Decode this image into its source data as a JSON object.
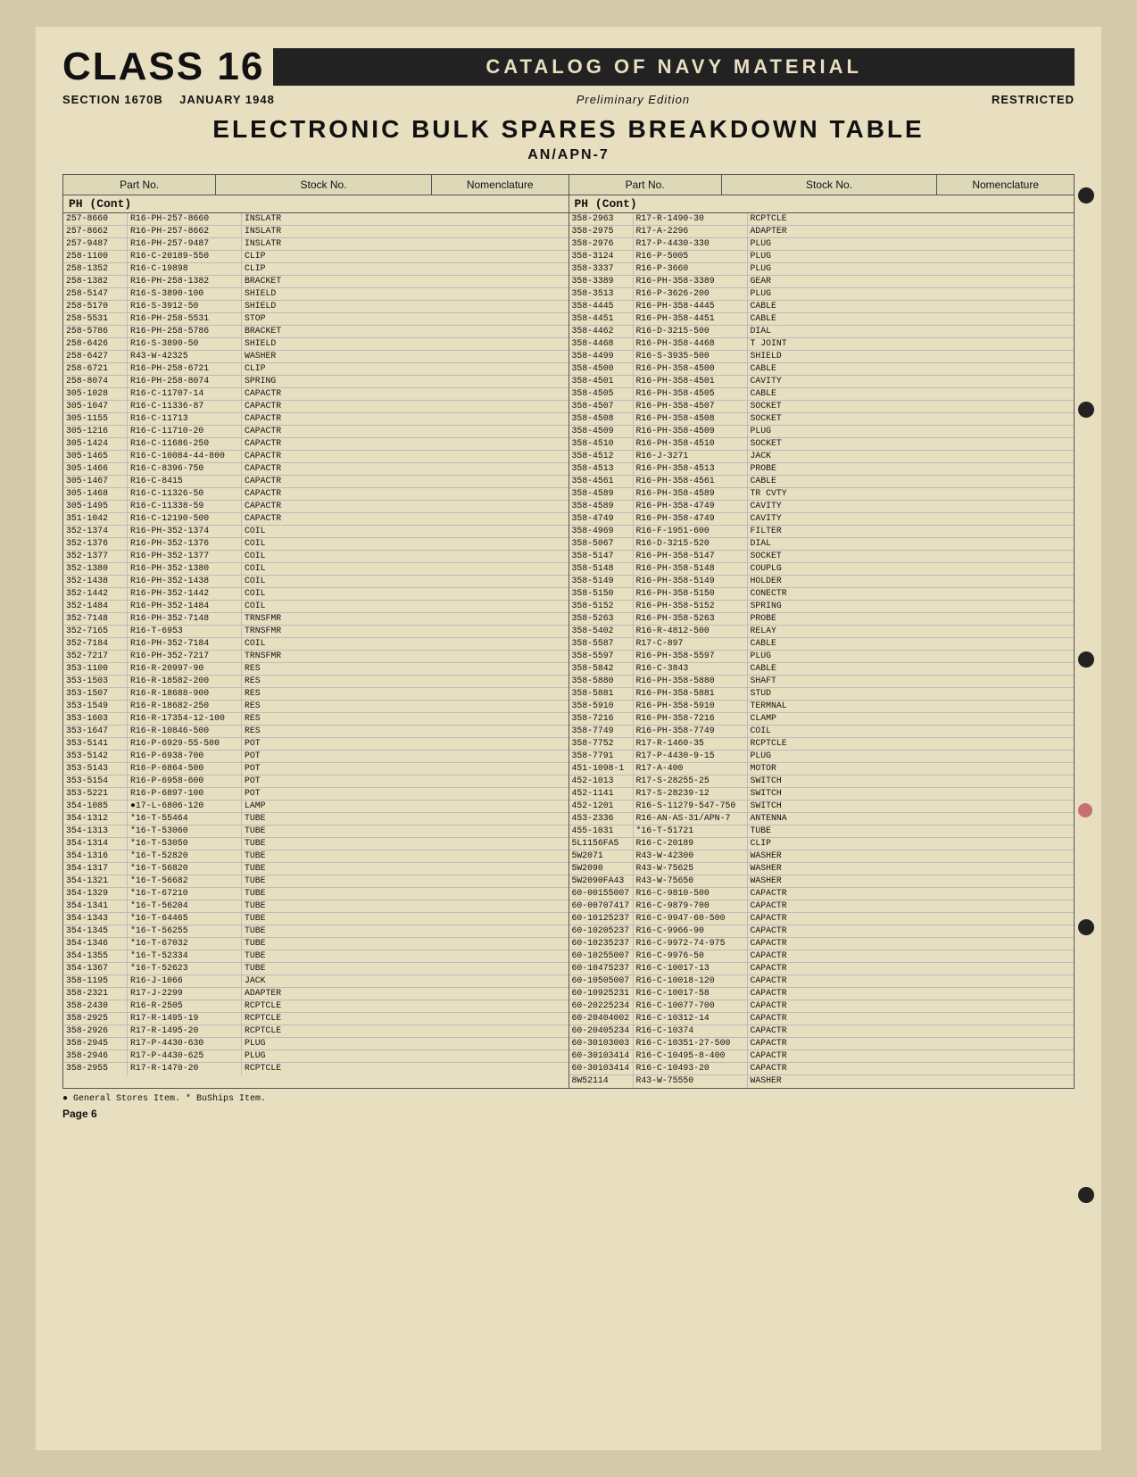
{
  "header": {
    "class_label": "CLASS 16",
    "catalog_title": "CATALOG OF NAVY MATERIAL",
    "section": "SECTION 1670B",
    "date": "JANUARY 1948",
    "edition": "Preliminary Edition",
    "restricted": "RESTRICTED",
    "page_title": "ELECTRONIC BULK SPARES BREAKDOWN TABLE",
    "sub_title": "AN/APN-7"
  },
  "table_headers": {
    "part_no": "Part No.",
    "stock_no": "Stock No.",
    "nomenclature": "Nomenclature",
    "part_no2": "Part No.",
    "stock_no2": "Stock No.",
    "nomenclature2": "Nomenclature"
  },
  "section_headers": {
    "left": "PH  (Cont)",
    "right": "PH  (Cont)"
  },
  "left_data": [
    [
      "257-8660",
      "R16-PH-257-8660",
      "INSLATR"
    ],
    [
      "257-8662",
      "R16-PH-257-8662",
      "INSLATR"
    ],
    [
      "257-9487",
      "R16-PH-257-9487",
      "INSLATR"
    ],
    [
      "258-1100",
      "R16-C-20189-550",
      "CLIP"
    ],
    [
      "258-1352",
      "R16-C-19898",
      "CLIP"
    ],
    [
      "258-1382",
      "R16-PH-258-1382",
      "BRACKET"
    ],
    [
      "258-5147",
      "R16-S-3890-100",
      "SHIELD"
    ],
    [
      "258-5170",
      "R16-S-3912-50",
      "SHIELD"
    ],
    [
      "258-5531",
      "R16-PH-258-5531",
      "STOP"
    ],
    [
      "258-5786",
      "R16-PH-258-5786",
      "BRACKET"
    ],
    [
      "258-6426",
      "R16-S-3890-50",
      "SHIELD"
    ],
    [
      "258-6427",
      "R43-W-42325",
      "WASHER"
    ],
    [
      "258-6721",
      "R16-PH-258-6721",
      "CLIP"
    ],
    [
      "258-8074",
      "R16-PH-258-8074",
      "SPRING"
    ],
    [
      "305-1028",
      "R16-C-11707-14",
      "CAPACTR"
    ],
    [
      "305-1047",
      "R16-C-11336-87",
      "CAPACTR"
    ],
    [
      "305-1155",
      "R16-C-11713",
      "CAPACTR"
    ],
    [
      "305-1216",
      "R16-C-11710-20",
      "CAPACTR"
    ],
    [
      "305-1424",
      "R16-C-11686-250",
      "CAPACTR"
    ],
    [
      "305-1465",
      "R16-C-10084-44-800",
      "CAPACTR"
    ],
    [
      "305-1466",
      "R16-C-8396-750",
      "CAPACTR"
    ],
    [
      "305-1467",
      "R16-C-8415",
      "CAPACTR"
    ],
    [
      "305-1468",
      "R16-C-11326-50",
      "CAPACTR"
    ],
    [
      "305-1495",
      "R16-C-11338-59",
      "CAPACTR"
    ],
    [
      "351-1042",
      "R16-C-12190-500",
      "CAPACTR"
    ],
    [
      "352-1374",
      "R16-PH-352-1374",
      "COIL"
    ],
    [
      "352-1376",
      "R16-PH-352-1376",
      "COIL"
    ],
    [
      "352-1377",
      "R16-PH-352-1377",
      "COIL"
    ],
    [
      "352-1380",
      "R16-PH-352-1380",
      "COIL"
    ],
    [
      "352-1438",
      "R16-PH-352-1438",
      "COIL"
    ],
    [
      "352-1442",
      "R16-PH-352-1442",
      "COIL"
    ],
    [
      "352-1484",
      "R16-PH-352-1484",
      "COIL"
    ],
    [
      "352-7148",
      "R16-PH-352-7148",
      "TRNSFMR"
    ],
    [
      "352-7165",
      "R16-T-6953",
      "TRNSFMR"
    ],
    [
      "352-7184",
      "R16-PH-352-7184",
      "COIL"
    ],
    [
      "352-7217",
      "R16-PH-352-7217",
      "TRNSFMR"
    ],
    [
      "353-1100",
      "R16-R-20997-90",
      "RES"
    ],
    [
      "353-1503",
      "R16-R-18582-200",
      "RES"
    ],
    [
      "353-1507",
      "R16-R-18688-900",
      "RES"
    ],
    [
      "353-1549",
      "R16-R-18682-250",
      "RES"
    ],
    [
      "353-1603",
      "R16-R-17354-12-100",
      "RES"
    ],
    [
      "353-1647",
      "R16-R-10846-500",
      "RES"
    ],
    [
      "353-5141",
      "R16-P-6929-55-500",
      "POT"
    ],
    [
      "353-5142",
      "R16-P-6938-700",
      "POT"
    ],
    [
      "353-5143",
      "R16-P-6864-500",
      "POT"
    ],
    [
      "353-5154",
      "R16-P-6958-600",
      "POT"
    ],
    [
      "353-5221",
      "R16-P-6897-100",
      "POT"
    ],
    [
      "354-1085",
      "●17-L-6806-120",
      "LAMP"
    ],
    [
      "354-1312",
      "*16-T-55464",
      "TUBE"
    ],
    [
      "354-1313",
      "*16-T-53060",
      "TUBE"
    ],
    [
      "354-1314",
      "*16-T-53050",
      "TUBE"
    ],
    [
      "354-1316",
      "*16-T-52820",
      "TUBE"
    ],
    [
      "354-1317",
      "*16-T-56820",
      "TUBE"
    ],
    [
      "354-1321",
      "*16-T-56682",
      "TUBE"
    ],
    [
      "354-1329",
      "*16-T-67210",
      "TUBE"
    ],
    [
      "354-1341",
      "*16-T-56204",
      "TUBE"
    ],
    [
      "354-1343",
      "*16-T-64465",
      "TUBE"
    ],
    [
      "354-1345",
      "*16-T-56255",
      "TUBE"
    ],
    [
      "354-1346",
      "*16-T-67032",
      "TUBE"
    ],
    [
      "354-1355",
      "*16-T-52334",
      "TUBE"
    ],
    [
      "354-1367",
      "*16-T-52623",
      "TUBE"
    ],
    [
      "358-1195",
      "R16-J-1066",
      "JACK"
    ],
    [
      "358-2321",
      "R17-J-2299",
      "ADAPTER"
    ],
    [
      "358-2430",
      "R16-R-2505",
      "RCPTCLE"
    ],
    [
      "358-2925",
      "R17-R-1495-19",
      "RCPTCLE"
    ],
    [
      "358-2926",
      "R17-R-1495-20",
      "RCPTCLE"
    ],
    [
      "358-2945",
      "R17-P-4430-630",
      "PLUG"
    ],
    [
      "358-2946",
      "R17-P-4430-625",
      "PLUG"
    ],
    [
      "358-2955",
      "R17-R-1470-20",
      "RCPTCLE"
    ]
  ],
  "right_data": [
    [
      "358-2963",
      "R17-R-1490-30",
      "RCPTCLE"
    ],
    [
      "358-2975",
      "R17-A-2296",
      "ADAPTER"
    ],
    [
      "358-2976",
      "R17-P-4430-330",
      "PLUG"
    ],
    [
      "358-3124",
      "R16-P-5005",
      "PLUG"
    ],
    [
      "358-3337",
      "R16-P-3660",
      "PLUG"
    ],
    [
      "358-3389",
      "R16-PH-358-3389",
      "GEAR"
    ],
    [
      "358-3513",
      "R16-P-3626-200",
      "PLUG"
    ],
    [
      "358-4445",
      "R16-PH-358-4445",
      "CABLE"
    ],
    [
      "358-4451",
      "R16-PH-358-4451",
      "CABLE"
    ],
    [
      "358-4462",
      "R16-D-3215-500",
      "DIAL"
    ],
    [
      "358-4468",
      "R16-PH-358-4468",
      "T JOINT"
    ],
    [
      "358-4499",
      "R16-S-3935-500",
      "SHIELD"
    ],
    [
      "358-4500",
      "R16-PH-358-4500",
      "CABLE"
    ],
    [
      "358-4501",
      "R16-PH-358-4501",
      "CAVITY"
    ],
    [
      "358-4505",
      "R16-PH-358-4505",
      "CABLE"
    ],
    [
      "358-4507",
      "R16-PH-358-4507",
      "SOCKET"
    ],
    [
      "358-4508",
      "R16-PH-358-4508",
      "SOCKET"
    ],
    [
      "358-4509",
      "R16-PH-358-4509",
      "PLUG"
    ],
    [
      "358-4510",
      "R16-PH-358-4510",
      "SOCKET"
    ],
    [
      "358-4512",
      "R16-J-3271",
      "JACK"
    ],
    [
      "358-4513",
      "R16-PH-358-4513",
      "PROBE"
    ],
    [
      "358-4561",
      "R16-PH-358-4561",
      "CABLE"
    ],
    [
      "358-4589",
      "R16-PH-358-4589",
      "TR CVTY"
    ],
    [
      "358-4589",
      "R16-PH-358-4749",
      "CAVITY"
    ],
    [
      "358-4749",
      "R16-PH-358-4749",
      "CAVITY"
    ],
    [
      "358-4969",
      "R16-F-1951-600",
      "FILTER"
    ],
    [
      "358-5067",
      "R16-D-3215-520",
      "DIAL"
    ],
    [
      "358-5147",
      "R16-PH-358-5147",
      "SOCKET"
    ],
    [
      "358-5148",
      "R16-PH-358-5148",
      "COUPLG"
    ],
    [
      "358-5149",
      "R16-PH-358-5149",
      "HOLDER"
    ],
    [
      "358-5150",
      "R16-PH-358-5150",
      "CONECTR"
    ],
    [
      "358-5152",
      "R16-PH-358-5152",
      "SPRING"
    ],
    [
      "358-5263",
      "R16-PH-358-5263",
      "PROBE"
    ],
    [
      "358-5402",
      "R16-R-4812-500",
      "RELAY"
    ],
    [
      "358-5587",
      "R17-C-897",
      "CABLE"
    ],
    [
      "358-5597",
      "R16-PH-358-5597",
      "PLUG"
    ],
    [
      "358-5842",
      "R16-C-3843",
      "CABLE"
    ],
    [
      "358-5880",
      "R16-PH-358-5880",
      "SHAFT"
    ],
    [
      "358-5881",
      "R16-PH-358-5881",
      "STUD"
    ],
    [
      "358-5910",
      "R16-PH-358-5910",
      "TERMNAL"
    ],
    [
      "358-7216",
      "R16-PH-358-7216",
      "CLAMP"
    ],
    [
      "358-7749",
      "R16-PH-358-7749",
      "COIL"
    ],
    [
      "358-7752",
      "R17-R-1460-35",
      "RCPTCLE"
    ],
    [
      "358-7791",
      "R17-P-4430-9-15",
      "PLUG"
    ],
    [
      "451-1098-1",
      "R17-A-400",
      "MOTOR"
    ],
    [
      "452-1013",
      "R17-S-28255-25",
      "SWITCH"
    ],
    [
      "452-1141",
      "R17-S-28239-12",
      "SWITCH"
    ],
    [
      "452-1201",
      "R16-S-11279-547-750",
      "SWITCH"
    ],
    [
      "453-2336",
      "R16-AN-AS-31/APN-7",
      "ANTENNA"
    ],
    [
      "455-1031",
      "*16-T-51721",
      "TUBE"
    ],
    [
      "5L1156FA5",
      "R16-C-20189",
      "CLIP"
    ],
    [
      "5W2071",
      "R43-W-42300",
      "WASHER"
    ],
    [
      "5W2090",
      "R43-W-75625",
      "WASHER"
    ],
    [
      "5W2090FA43",
      "R43-W-75650",
      "WASHER"
    ],
    [
      "60-00155007",
      "R16-C-9810-500",
      "CAPACTR"
    ],
    [
      "60-00707417",
      "R16-C-9879-700",
      "CAPACTR"
    ],
    [
      "60-10125237",
      "R16-C-9947-60-500",
      "CAPACTR"
    ],
    [
      "60-10205237",
      "R16-C-9966-90",
      "CAPACTR"
    ],
    [
      "60-10235237",
      "R16-C-9972-74-975",
      "CAPACTR"
    ],
    [
      "60-10255007",
      "R16-C-9976-50",
      "CAPACTR"
    ],
    [
      "60-10475237",
      "R16-C-10017-13",
      "CAPACTR"
    ],
    [
      "60-10505007",
      "R16-C-10018-120",
      "CAPACTR"
    ],
    [
      "60-10925231",
      "R16-C-10017-58",
      "CAPACTR"
    ],
    [
      "60-20225234",
      "R16-C-10077-700",
      "CAPACTR"
    ],
    [
      "60-20404002",
      "R16-C-10312-14",
      "CAPACTR"
    ],
    [
      "60-20405234",
      "R16-C-10374",
      "CAPACTR"
    ],
    [
      "60-30103003",
      "R16-C-10351-27-500",
      "CAPACTR"
    ],
    [
      "60-30103414",
      "R16-C-10495-8-400",
      "CAPACTR"
    ],
    [
      "60-30103414",
      "R16-C-10493-20",
      "CAPACTR"
    ],
    [
      "8W52114",
      "R43-W-75550",
      "WASHER"
    ]
  ],
  "footer": {
    "note": "● General Stores Item.  * BuShips Item.",
    "page": "Page 6"
  }
}
